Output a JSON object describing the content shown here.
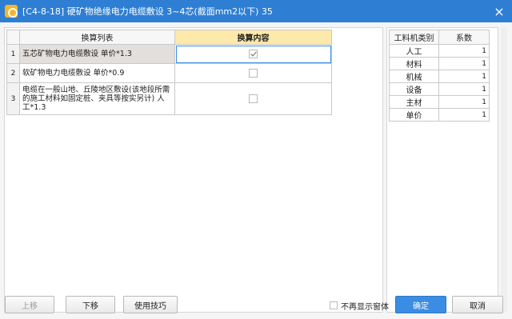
{
  "window": {
    "title": "[C4-8-18] 硬矿物绝缘电力电缆敷设 3~4芯(截面mm2以下) 35",
    "close_glyph": "×"
  },
  "conversion_grid": {
    "headers": [
      "换算列表",
      "换算内容"
    ],
    "rows": [
      {
        "num": "1",
        "desc": "五芯矿物电力电缆敷设 单价*1.3",
        "checked": true
      },
      {
        "num": "2",
        "desc": "软矿物电力电缆敷设 单价*0.9",
        "checked": false
      },
      {
        "num": "3",
        "desc": "电缆在一般山地、丘陵地区敷设(该地段所需的施工材料如固定桩、夹具等按实另计) 人工*1.3",
        "checked": false
      }
    ]
  },
  "coefficients": {
    "headers": [
      "工料机类别",
      "系数"
    ],
    "rows": [
      {
        "category": "人工",
        "value": "1"
      },
      {
        "category": "材料",
        "value": "1"
      },
      {
        "category": "机械",
        "value": "1"
      },
      {
        "category": "设备",
        "value": "1"
      },
      {
        "category": "主材",
        "value": "1"
      },
      {
        "category": "单价",
        "value": "1"
      }
    ]
  },
  "footer": {
    "move_up": "上移",
    "move_down": "下移",
    "tips": "使用技巧",
    "dont_show": "不再显示窗体",
    "ok": "确定",
    "cancel": "取消"
  },
  "colors": {
    "titlebar": "#2e7fd3",
    "primary_button": "#3a8de2",
    "header_highlight": "#fde9a9"
  }
}
